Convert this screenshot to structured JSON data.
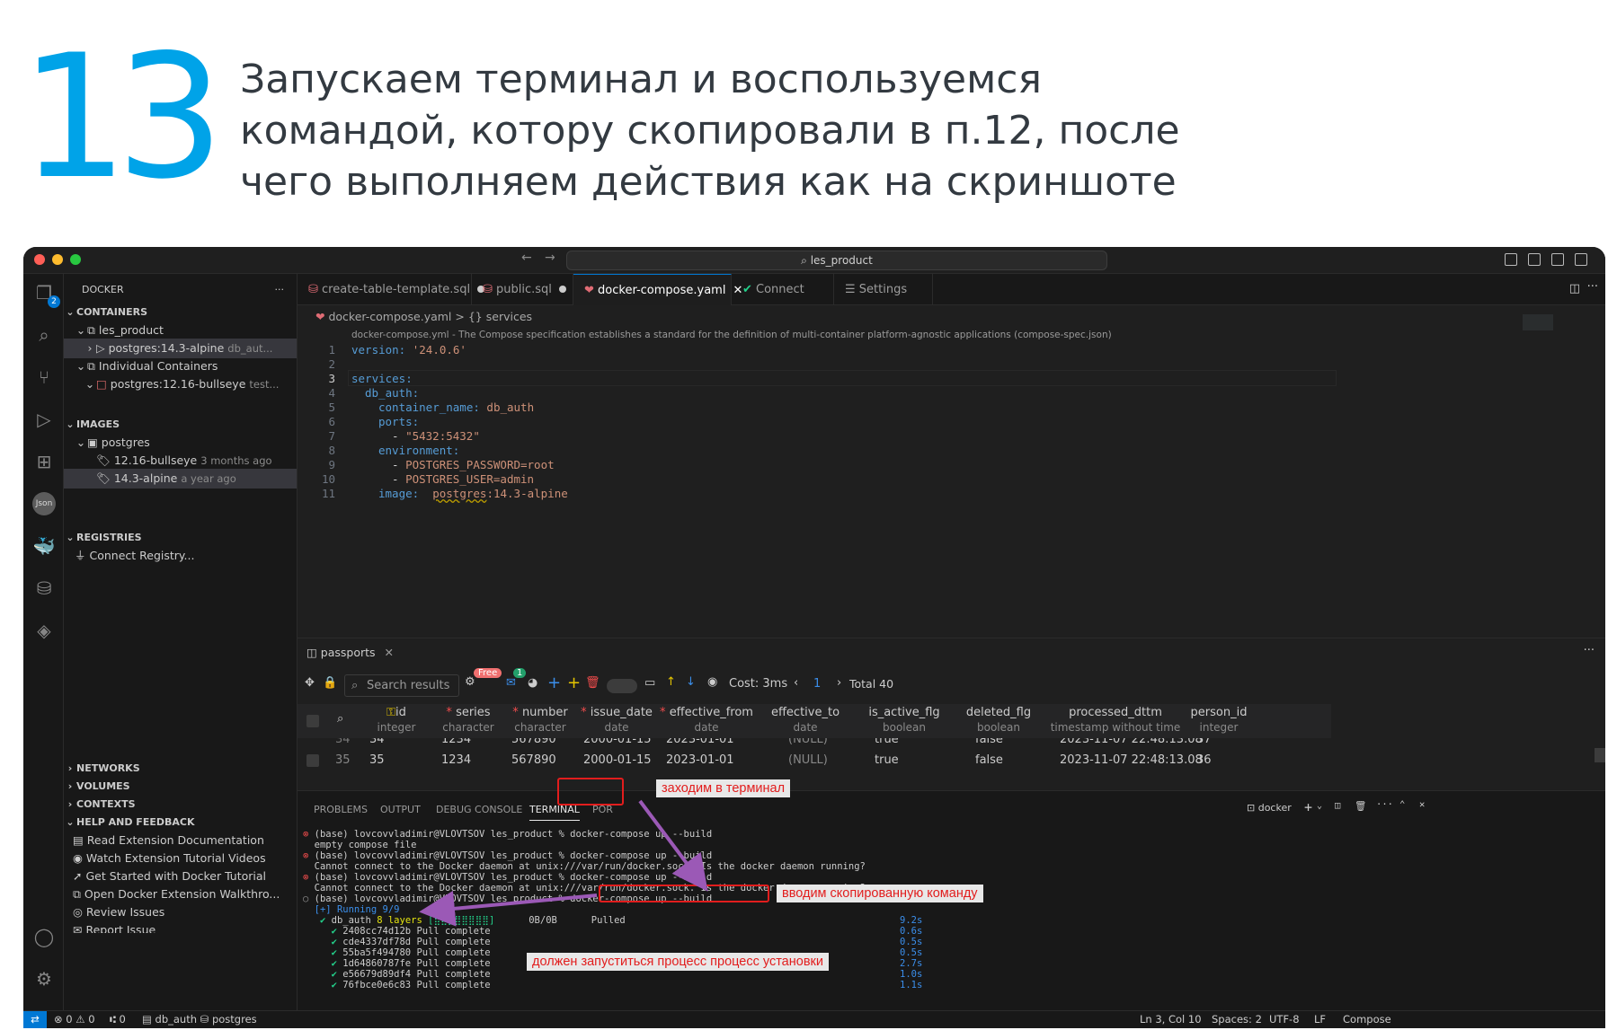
{
  "heading": {
    "number": "13",
    "lines": [
      "Запускаем терминал и воспользуемся",
      "командой, котору скопировали в п.12, после",
      "чего выполняем действия как на скриншоте"
    ]
  },
  "window": {
    "command_center": "les_product",
    "activity_badge": "2"
  },
  "sidebar": {
    "title": "DOCKER",
    "more": "···",
    "sections": {
      "containers": "CONTAINERS",
      "images": "IMAGES",
      "registries": "REGISTRIES",
      "networks": "NETWORKS",
      "volumes": "VOLUMES",
      "contexts": "CONTEXTS",
      "help": "HELP AND FEEDBACK"
    },
    "containers": {
      "group1": "les_product",
      "item1_name": "postgres:14.3-alpine",
      "item1_desc": "db_aut...",
      "group2": "Individual Containers",
      "item2_name": "postgres:12.16-bullseye",
      "item2_desc": "test..."
    },
    "images": {
      "group": "postgres",
      "tag1": "12.16-bullseye",
      "tag1_age": "3 months ago",
      "tag2": "14.3-alpine",
      "tag2_age": "a year ago"
    },
    "registries": {
      "connect": "Connect Registry..."
    },
    "help_items": [
      "Read Extension Documentation",
      "Watch Extension Tutorial Videos",
      "Get Started with Docker Tutorial",
      "Open Docker Extension Walkthro...",
      "Review Issues",
      "Report Issue"
    ]
  },
  "tabs": [
    {
      "label": "create-table-template.sql"
    },
    {
      "label": "public.sql"
    },
    {
      "label": "docker-compose.yaml"
    },
    {
      "label": "Connect"
    },
    {
      "label": "Settings"
    }
  ],
  "editor": {
    "breadcrumb_file": "docker-compose.yaml",
    "breadcrumb_sep": ">",
    "breadcrumb_node": "{} services",
    "schema_hint": "docker-compose.yml - The Compose specification establishes a standard for the definition of multi-container platform-agnostic applications (compose-spec.json)",
    "line_numbers": [
      "1",
      "2",
      "3",
      "4",
      "5",
      "6",
      "7",
      "8",
      "9",
      "10",
      "11"
    ],
    "lines": {
      "l1_key": "version:",
      "l1_val": "'24.0.6'",
      "l3_key": "services:",
      "l4_key": "db_auth:",
      "l5_key": "container_name:",
      "l5_val": "db_auth",
      "l6_key": "ports:",
      "l7_dash": "- ",
      "l7_val": "\"5432:5432\"",
      "l8_key": "environment:",
      "l9_dash": "- ",
      "l9_val": "POSTGRES_PASSWORD=root",
      "l10_dash": "- ",
      "l10_val": "POSTGRES_USER=admin",
      "l11_key": "image:",
      "l11_val1": "postgres",
      "l11_val2": ":14.3-alpine"
    }
  },
  "results": {
    "tab_label": "passports",
    "search_placeholder": "Search results",
    "free_badge": "Free",
    "notif_badge": "1",
    "cost": "Cost: 3ms",
    "page": "1",
    "total": "Total 40",
    "columns": [
      {
        "name": "id",
        "type": "integer"
      },
      {
        "name": "series",
        "type": "character"
      },
      {
        "name": "number",
        "type": "character"
      },
      {
        "name": "issue_date",
        "type": "date"
      },
      {
        "name": "effective_from",
        "type": "date"
      },
      {
        "name": "effective_to",
        "type": "date"
      },
      {
        "name": "is_active_flg",
        "type": "boolean"
      },
      {
        "name": "deleted_flg",
        "type": "boolean"
      },
      {
        "name": "processed_dttm",
        "type": "timestamp without time"
      },
      {
        "name": "person_id",
        "type": "integer"
      }
    ],
    "partial_row": [
      "34",
      "34",
      "1234",
      "567890",
      "2000-01-15",
      "2023-01-01",
      "(NULL)",
      "true",
      "false",
      "2023-11-07 22:48:13.08",
      "37"
    ],
    "row": [
      "35",
      "35",
      "1234",
      "567890",
      "2000-01-15",
      "2023-01-01",
      "(NULL)",
      "true",
      "false",
      "2023-11-07 22:48:13.08",
      "36"
    ]
  },
  "terminal": {
    "tabs": [
      "PROBLEMS",
      "OUTPUT",
      "DEBUG CONSOLE",
      "TERMINAL",
      "POR"
    ],
    "shell_name": "docker",
    "lines": [
      "(base) lovcovvladimir@VLOVTSOV les_product % docker-compose up --build",
      "empty compose file",
      "(base) lovcovvladimir@VLOVTSOV les_product % docker-compose up --build",
      "Cannot connect to the Docker daemon at unix:///var/run/docker.sock. Is the docker daemon running?",
      "(base) lovcovvladimir@VLOVTSOV les_product % docker-compose up --build",
      "Cannot connect to the Docker daemon at unix:///var/run/docker.sock. Is the docker daemon running?",
      "(base) lovcovvladimir@VLOVTSOV les_product % docker-compose up --build"
    ],
    "running": "[+] Running 9/9",
    "db_auth": "db_auth",
    "layers": "8 layers",
    "progress": "[⣿⣿⣿⣿⣿⣿⣿⣿]",
    "size": "0B/0B",
    "pulled": "Pulled",
    "pulls": [
      "2408cc74d12b Pull complete",
      "cde4337df78d Pull complete",
      "55ba5f494780 Pull complete",
      "1d64860787fe Pull complete",
      "e56679d89df4 Pull complete",
      "76fbce0e6c83 Pull complete"
    ],
    "times": [
      "9.2s",
      "0.6s",
      "0.5s",
      "0.5s",
      "2.7s",
      "1.0s",
      "1.1s"
    ]
  },
  "statusbar": {
    "problems": "⊗ 0 ⚠ 0",
    "ports": "⑆ 0",
    "db": "db_auth",
    "db2": "postgres",
    "position": "Ln 3, Col 10",
    "spaces": "Spaces: 2",
    "encoding": "UTF-8",
    "eol": "LF",
    "language": "Compose"
  },
  "annotations": {
    "terminal_hint": "заходим в терминал",
    "command_hint": "вводим скопированную команду",
    "install_hint": "должен запуститься процесс процесс установки"
  },
  "colors": {
    "accent": "#00a3e8",
    "annotation": "#e21d1d",
    "arrow": "#9b59b6",
    "vscode_blue": "#0078d4"
  }
}
